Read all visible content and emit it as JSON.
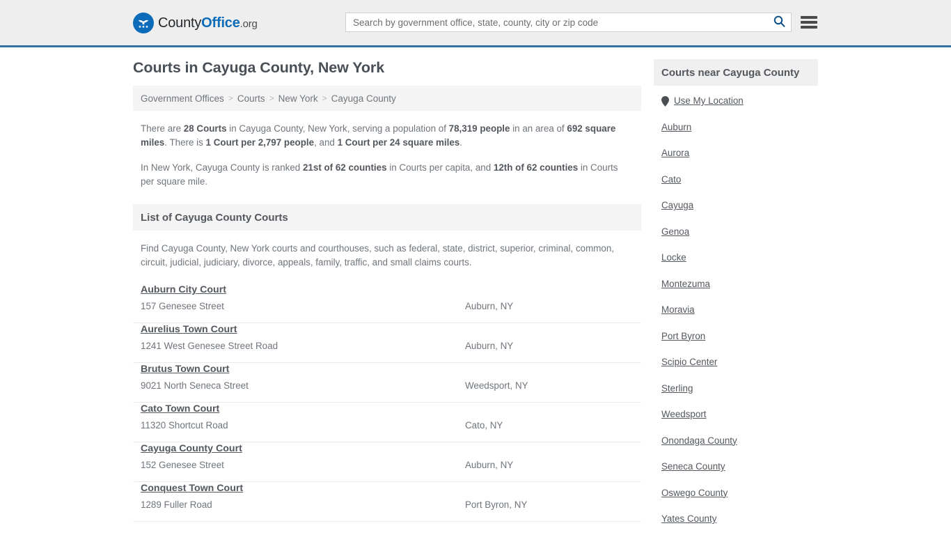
{
  "header": {
    "brand": {
      "part1": "County",
      "part2": "Office",
      "part3": ".org",
      "logo_icon": "eagle-seal-icon"
    },
    "search": {
      "placeholder": "Search by government office, state, county, city or zip code",
      "value": "",
      "search_icon": "search-icon"
    },
    "menu_icon": "hamburger-menu-icon",
    "accent_color": "#36719f",
    "background_color": "#eeeeee"
  },
  "main": {
    "title": "Courts in Cayuga County, New York",
    "breadcrumb": [
      {
        "label": "Government Offices"
      },
      {
        "label": "Courts"
      },
      {
        "label": "New York"
      },
      {
        "label": "Cayuga County"
      }
    ],
    "breadcrumb_separator": ">",
    "stats_paragraph_1": {
      "segments": [
        {
          "text": "There are ",
          "bold": false
        },
        {
          "text": "28 Courts",
          "bold": true
        },
        {
          "text": " in Cayuga County, New York, serving a population of ",
          "bold": false
        },
        {
          "text": "78,319 people",
          "bold": true
        },
        {
          "text": " in an area of ",
          "bold": false
        },
        {
          "text": "692 square miles",
          "bold": true
        },
        {
          "text": ". There is ",
          "bold": false
        },
        {
          "text": "1 Court per 2,797 people",
          "bold": true
        },
        {
          "text": ", and ",
          "bold": false
        },
        {
          "text": "1 Court per 24 square miles",
          "bold": true
        },
        {
          "text": ".",
          "bold": false
        }
      ]
    },
    "stats_paragraph_2": {
      "segments": [
        {
          "text": "In New York, Cayuga County is ranked ",
          "bold": false
        },
        {
          "text": "21st of 62 counties",
          "bold": true
        },
        {
          "text": " in Courts per capita, and ",
          "bold": false
        },
        {
          "text": "12th of 62 counties",
          "bold": true
        },
        {
          "text": " in Courts per square mile.",
          "bold": false
        }
      ]
    },
    "list_heading": "List of Cayuga County Courts",
    "list_description": "Find Cayuga County, New York courts and courthouses, such as federal, state, district, superior, criminal, common, circuit, judicial, judiciary, divorce, appeals, family, traffic, and small claims courts.",
    "courts": [
      {
        "name": "Auburn City Court",
        "address": "157 Genesee Street",
        "city": "Auburn, NY"
      },
      {
        "name": "Aurelius Town Court",
        "address": "1241 West Genesee Street Road",
        "city": "Auburn, NY"
      },
      {
        "name": "Brutus Town Court",
        "address": "9021 North Seneca Street",
        "city": "Weedsport, NY"
      },
      {
        "name": "Cato Town Court",
        "address": "11320 Shortcut Road",
        "city": "Cato, NY"
      },
      {
        "name": "Cayuga County Court",
        "address": "152 Genesee Street",
        "city": "Auburn, NY"
      },
      {
        "name": "Conquest Town Court",
        "address": "1289 Fuller Road",
        "city": "Port Byron, NY"
      }
    ]
  },
  "sidebar": {
    "heading": "Courts near Cayuga County",
    "use_my_location": {
      "label": "Use My Location",
      "icon": "map-pin-icon"
    },
    "places": [
      {
        "label": "Auburn"
      },
      {
        "label": "Aurora"
      },
      {
        "label": "Cato"
      },
      {
        "label": "Cayuga"
      },
      {
        "label": "Genoa"
      },
      {
        "label": "Locke"
      },
      {
        "label": "Montezuma"
      },
      {
        "label": "Moravia"
      },
      {
        "label": "Port Byron"
      },
      {
        "label": "Scipio Center"
      },
      {
        "label": "Sterling"
      },
      {
        "label": "Weedsport"
      },
      {
        "label": "Onondaga County"
      },
      {
        "label": "Seneca County"
      },
      {
        "label": "Oswego County"
      },
      {
        "label": "Yates County"
      }
    ]
  }
}
